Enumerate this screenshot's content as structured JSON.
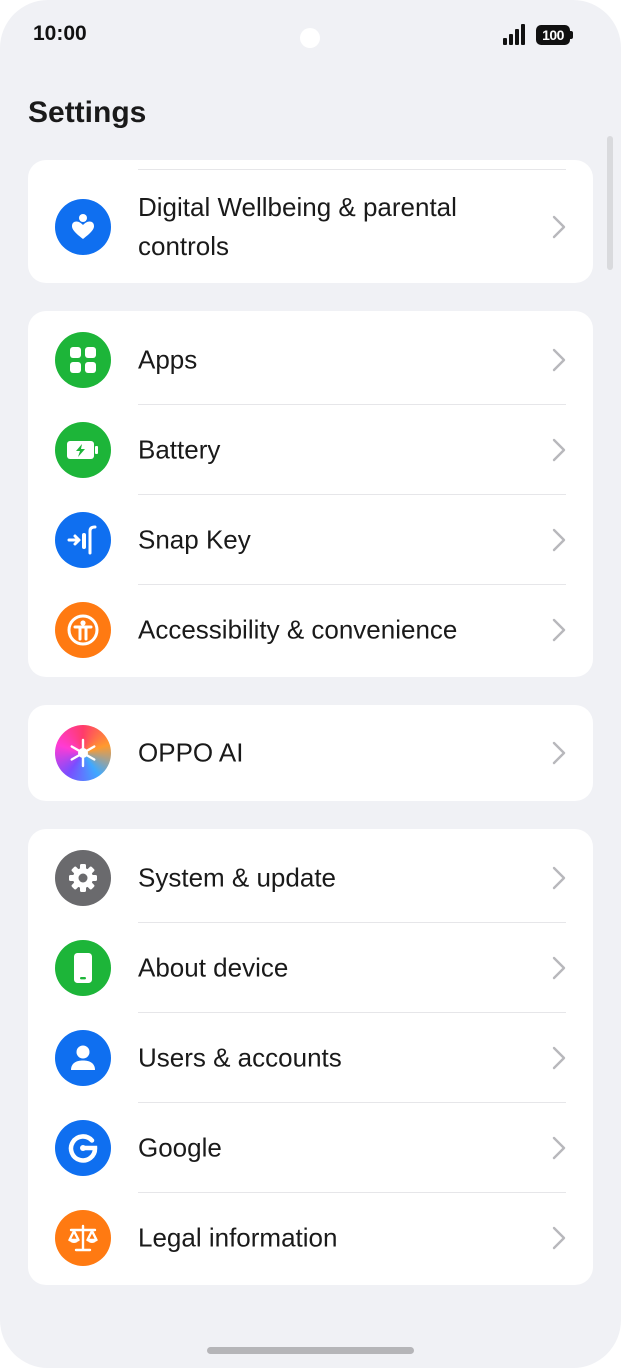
{
  "status": {
    "time": "10:00",
    "battery": "100"
  },
  "header": {
    "title": "Settings"
  },
  "colors": {
    "blue": "#0f6ff0",
    "green": "#1db539",
    "orange": "#ff7a12",
    "gray": "#6a6a6d"
  },
  "card1": {
    "items": [
      {
        "label": "Digital Wellbeing & parental controls",
        "icon": "heart-person-icon"
      }
    ]
  },
  "card2": {
    "items": [
      {
        "label": "Apps",
        "icon": "apps-grid-icon"
      },
      {
        "label": "Battery",
        "icon": "battery-icon"
      },
      {
        "label": "Snap Key",
        "icon": "snap-key-icon"
      },
      {
        "label": "Accessibility & convenience",
        "icon": "accessibility-icon"
      }
    ]
  },
  "card3": {
    "items": [
      {
        "label": "OPPO AI",
        "icon": "oppo-ai-icon"
      }
    ]
  },
  "card4": {
    "items": [
      {
        "label": "System & update",
        "icon": "gear-icon"
      },
      {
        "label": "About device",
        "icon": "phone-icon"
      },
      {
        "label": "Users & accounts",
        "icon": "user-icon"
      },
      {
        "label": "Google",
        "icon": "google-icon"
      },
      {
        "label": "Legal information",
        "icon": "scales-icon"
      }
    ]
  }
}
